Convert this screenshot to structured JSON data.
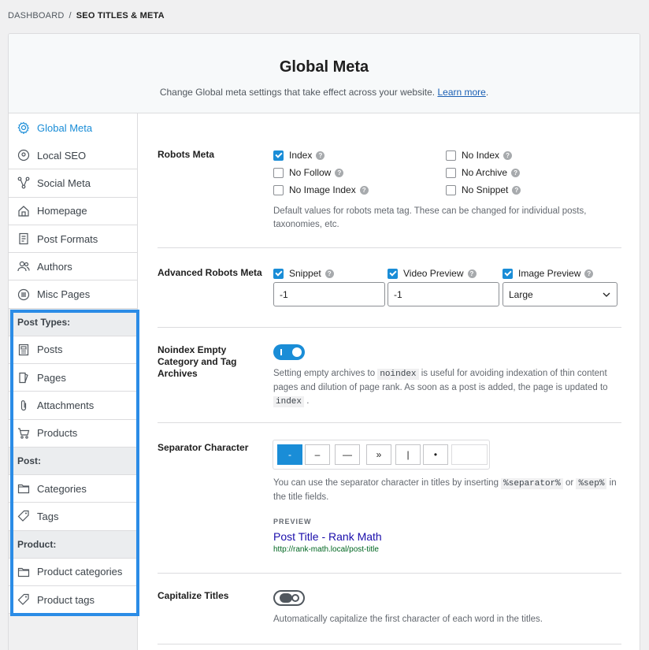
{
  "breadcrumb": {
    "root": "DASHBOARD",
    "separator": "/",
    "current": "SEO TITLES & META"
  },
  "header": {
    "title": "Global Meta",
    "description": "Change Global meta settings that take effect across your website.",
    "link": "Learn more",
    "link_suffix": "."
  },
  "sidebar": {
    "items": [
      {
        "label": "Global Meta",
        "icon": "gear-icon",
        "active": true
      },
      {
        "label": "Local SEO",
        "icon": "location-pin-icon"
      },
      {
        "label": "Social Meta",
        "icon": "share-nodes-icon"
      },
      {
        "label": "Homepage",
        "icon": "home-icon"
      },
      {
        "label": "Post Formats",
        "icon": "document-icon"
      },
      {
        "label": "Authors",
        "icon": "users-icon"
      },
      {
        "label": "Misc Pages",
        "icon": "list-circle-icon"
      }
    ],
    "groups": [
      {
        "title": "Post Types:",
        "items": [
          {
            "label": "Posts",
            "icon": "post-icon"
          },
          {
            "label": "Pages",
            "icon": "pages-icon"
          },
          {
            "label": "Attachments",
            "icon": "paperclip-icon"
          },
          {
            "label": "Products",
            "icon": "cart-icon"
          }
        ]
      },
      {
        "title": "Post:",
        "items": [
          {
            "label": "Categories",
            "icon": "folder-icon"
          },
          {
            "label": "Tags",
            "icon": "tag-icon"
          }
        ]
      },
      {
        "title": "Product:",
        "items": [
          {
            "label": "Product categories",
            "icon": "folder-icon"
          },
          {
            "label": "Product tags",
            "icon": "tag-icon"
          }
        ]
      }
    ]
  },
  "robots": {
    "label": "Robots Meta",
    "options": [
      {
        "label": "Index",
        "checked": true
      },
      {
        "label": "No Index",
        "checked": false
      },
      {
        "label": "No Follow",
        "checked": false
      },
      {
        "label": "No Archive",
        "checked": false
      },
      {
        "label": "No Image Index",
        "checked": false
      },
      {
        "label": "No Snippet",
        "checked": false
      }
    ],
    "desc": "Default values for robots meta tag. These can be changed for individual posts, taxonomies, etc."
  },
  "advanced": {
    "label": "Advanced Robots Meta",
    "snippet": {
      "label": "Snippet",
      "value": "-1"
    },
    "video": {
      "label": "Video Preview",
      "value": "-1"
    },
    "image": {
      "label": "Image Preview",
      "value": "Large"
    }
  },
  "noindex": {
    "label": "Noindex Empty Category and Tag Archives",
    "desc_a": "Setting empty archives to",
    "code_a": "noindex",
    "desc_b": "is useful for avoiding indexation of thin content pages and dilution of page rank. As soon as a post is added, the page is updated to",
    "code_b": "index",
    "desc_c": "."
  },
  "separator": {
    "label": "Separator Character",
    "options": [
      "-",
      "–",
      "—",
      "»",
      "|",
      "•",
      ""
    ],
    "desc_a": "You can use the separator character in titles by inserting",
    "code_a": "%separator%",
    "desc_b": "or",
    "code_b": "%sep%",
    "desc_c": "in the title fields.",
    "preview_label": "PREVIEW",
    "preview_title": "Post Title - Rank Math",
    "preview_url": "http://rank-math.local/post-title"
  },
  "capitalize": {
    "label": "Capitalize Titles",
    "desc": "Automatically capitalize the first character of each word in the titles."
  }
}
